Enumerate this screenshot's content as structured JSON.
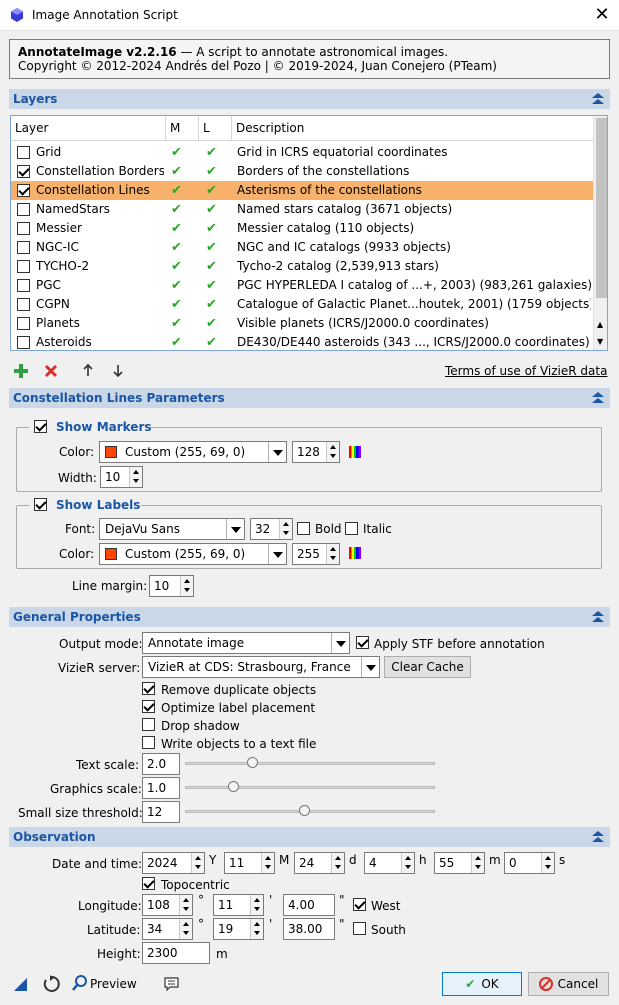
{
  "window": {
    "title": "Image Annotation Script"
  },
  "banner": {
    "line1_bold": "AnnotateImage v2.2.16",
    "line1_rest": " — A script to annotate astronomical images.",
    "line2": "Copyright © 2012-2024 Andrés del Pozo | © 2019-2024, Juan Conejero (PTeam)"
  },
  "layers": {
    "section_title": "Layers",
    "columns": [
      "Layer",
      "M",
      "L",
      "Description"
    ],
    "check_glyph": "✔",
    "rows": [
      {
        "name": "Grid",
        "checked": false,
        "selected": false,
        "description": "Grid in ICRS equatorial coordinates"
      },
      {
        "name": "Constellation Borders",
        "checked": true,
        "selected": false,
        "description": "Borders of the constellations"
      },
      {
        "name": "Constellation Lines",
        "checked": true,
        "selected": true,
        "description": "Asterisms of the constellations"
      },
      {
        "name": "NamedStars",
        "checked": false,
        "selected": false,
        "description": "Named stars catalog (3671 objects)"
      },
      {
        "name": "Messier",
        "checked": false,
        "selected": false,
        "description": "Messier catalog (110 objects)"
      },
      {
        "name": "NGC-IC",
        "checked": false,
        "selected": false,
        "description": "NGC and IC catalogs (9933 objects)"
      },
      {
        "name": "TYCHO-2",
        "checked": false,
        "selected": false,
        "description": "Tycho-2 catalog (2,539,913 stars)"
      },
      {
        "name": "PGC",
        "checked": false,
        "selected": false,
        "description": "PGC HYPERLEDA I catalog of ...+, 2003) (983,261 galaxies)"
      },
      {
        "name": "CGPN",
        "checked": false,
        "selected": false,
        "description": "Catalogue of Galactic Planet...houtek, 2001) (1759 objects)"
      },
      {
        "name": "Planets",
        "checked": false,
        "selected": false,
        "description": "Visible planets (ICRS/J2000.0 coordinates)"
      },
      {
        "name": "Asteroids",
        "checked": false,
        "selected": false,
        "description": "DE430/DE440 asteroids (343 ..., ICRS/J2000.0 coordinates)"
      }
    ],
    "terms_link": "Terms of use of VizieR data"
  },
  "params": {
    "section_title": "Constellation Lines Parameters",
    "show_markers": "Show Markers",
    "color_label": "Color:",
    "marker_color": "Custom (255, 69,  0)",
    "marker_alpha": "128",
    "width_label": "Width:",
    "width_value": "10",
    "show_labels": "Show Labels",
    "font_label": "Font:",
    "font_value": "DejaVu Sans",
    "font_size": "32",
    "bold_label": "Bold",
    "italic_label": "Italic",
    "label_color": "Custom (255, 69,  0)",
    "label_alpha": "255",
    "line_margin_label": "Line margin:",
    "line_margin_value": "10",
    "color_hex": "#ff4500"
  },
  "general": {
    "section_title": "General Properties",
    "output_mode_label": "Output mode:",
    "output_mode_value": "Annotate image",
    "apply_stf": "Apply STF before annotation",
    "vizier_label": "VizieR server:",
    "vizier_value": "VizieR at CDS: Strasbourg, France",
    "clear_cache": "Clear Cache",
    "remove_dup": "Remove duplicate objects",
    "optimize": "Optimize label placement",
    "drop_shadow": "Drop shadow",
    "write_objects": "Write objects to a text file",
    "text_scale_label": "Text scale:",
    "text_scale_value": "2.0",
    "graphics_scale_label": "Graphics scale:",
    "graphics_scale_value": "1.0",
    "small_size_label": "Small size threshold:",
    "small_size_value": "12"
  },
  "observation": {
    "section_title": "Observation",
    "date_label": "Date and time:",
    "year": "2024",
    "year_unit": "Y",
    "month": "11",
    "month_unit": "M",
    "day": "24",
    "day_unit": "d",
    "hour": "4",
    "hour_unit": "h",
    "minute": "55",
    "minute_unit": "m",
    "second": "0",
    "second_unit": "s",
    "topocentric": "Topocentric",
    "longitude_label": "Longitude:",
    "lon_deg": "108",
    "lon_min": "11",
    "lon_sec": "4.00",
    "west": "West",
    "latitude_label": "Latitude:",
    "lat_deg": "34",
    "lat_min": "19",
    "lat_sec": "38.00",
    "south": "South",
    "height_label": "Height:",
    "height_value": "2300",
    "height_unit": "m",
    "deg_sym": "°",
    "min_sym": "'",
    "sec_sym": "\""
  },
  "footer": {
    "preview": "Preview",
    "ok": "OK",
    "cancel": "Cancel"
  }
}
